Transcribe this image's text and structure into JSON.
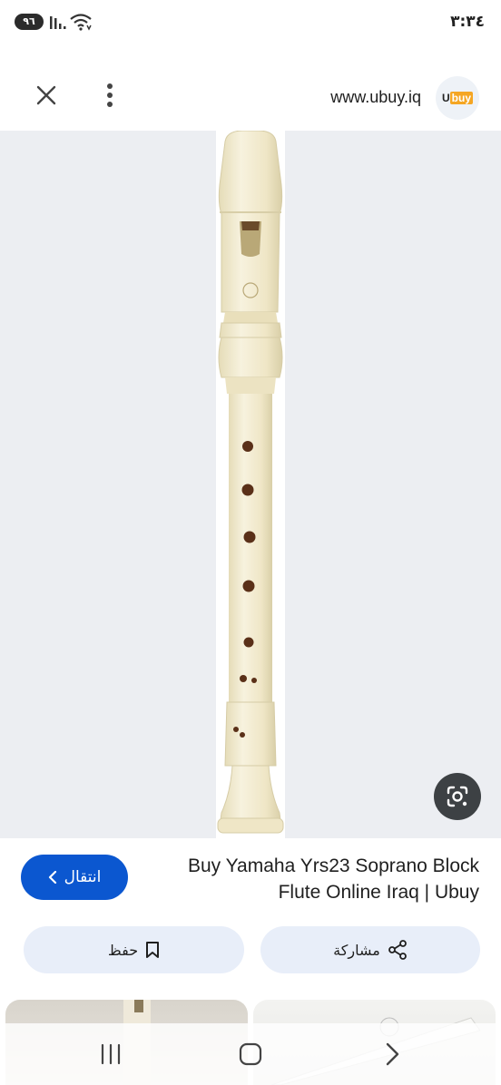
{
  "status_bar": {
    "battery": "٩٦",
    "time": "٣:٣٤",
    "icons": [
      "signal-icon",
      "wifi-icon"
    ]
  },
  "header": {
    "domain": "www.ubuy.iq",
    "logo_text_u": "U",
    "logo_text_buy": "buy",
    "icons": [
      "close-icon",
      "more-vert-icon"
    ]
  },
  "image": {
    "lens_icon": "google-lens-icon"
  },
  "result": {
    "title": "Buy Yamaha Yrs23 Soprano Block Flute Online Iraq | Ubuy",
    "visit_label": "انتقال",
    "visit_icon": "chevron-left-icon"
  },
  "actions": {
    "save_label": "حفظ",
    "save_icon": "bookmark-icon",
    "share_label": "مشاركة",
    "share_icon": "share-icon"
  },
  "nav": {
    "icons": [
      "recent-apps-icon",
      "home-icon",
      "back-icon"
    ]
  },
  "colors": {
    "primary": "#0b57d0",
    "action_bg": "#e8eef9",
    "image_bg": "#eceef2",
    "flute": "#f3edd2"
  }
}
